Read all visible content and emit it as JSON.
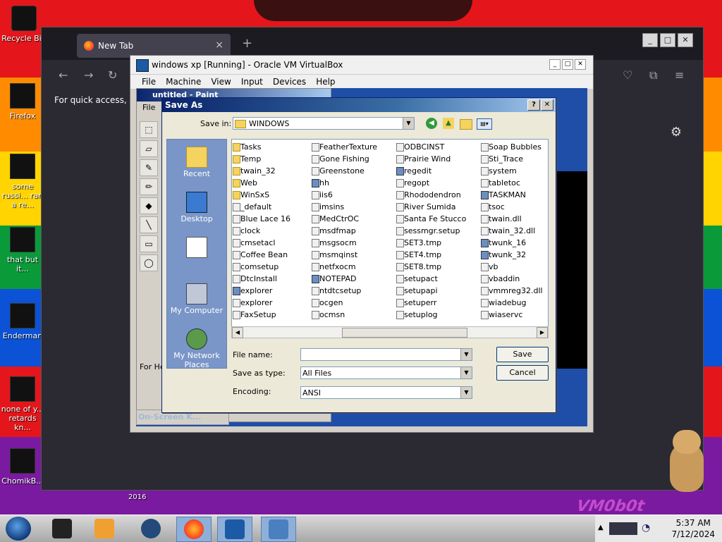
{
  "desktop": {
    "icons": [
      {
        "label": "Recycle Bin"
      },
      {
        "label": "Firefox"
      },
      {
        "label": "some russi... ran a re..."
      },
      {
        "label": "that but it..."
      },
      {
        "label": "Enderman"
      },
      {
        "label": "none of y... retards kn..."
      },
      {
        "label": "ChomikB..."
      }
    ],
    "overlay_text": "VM0b0t",
    "small_label": "2016"
  },
  "firefox": {
    "tab_title": "New Tab",
    "bookmarks_hint": "For quick access, pla",
    "new_tab_symbol": "+"
  },
  "vbox": {
    "title": "windows xp [Running] - Oracle VM VirtualBox",
    "menu": [
      "File",
      "Machine",
      "View",
      "Input",
      "Devices",
      "Help"
    ]
  },
  "paint": {
    "title": "untitled - Paint",
    "menu_file": "File",
    "status": "For He",
    "osk_title": "On-Screen K..."
  },
  "dialog": {
    "title": "Save As",
    "save_in_label": "Save in:",
    "save_in_value": "WINDOWS",
    "places": [
      "Recent",
      "Desktop",
      "",
      "My Computer",
      "My Network Places"
    ],
    "columns": [
      [
        {
          "name": "Tasks",
          "type": "folder"
        },
        {
          "name": "Temp",
          "type": "folder"
        },
        {
          "name": "twain_32",
          "type": "folder"
        },
        {
          "name": "Web",
          "type": "folder"
        },
        {
          "name": "WinSxS",
          "type": "folder"
        },
        {
          "name": "_default",
          "type": "file"
        },
        {
          "name": "Blue Lace 16",
          "type": "file"
        },
        {
          "name": "clock",
          "type": "file"
        },
        {
          "name": "cmsetacl",
          "type": "file"
        },
        {
          "name": "Coffee Bean",
          "type": "file"
        },
        {
          "name": "comsetup",
          "type": "file"
        },
        {
          "name": "DtcInstall",
          "type": "file"
        },
        {
          "name": "explorer",
          "type": "app"
        },
        {
          "name": "explorer",
          "type": "file"
        },
        {
          "name": "FaxSetup",
          "type": "file"
        }
      ],
      [
        {
          "name": "FeatherTexture",
          "type": "file"
        },
        {
          "name": "Gone Fishing",
          "type": "file"
        },
        {
          "name": "Greenstone",
          "type": "file"
        },
        {
          "name": "hh",
          "type": "app"
        },
        {
          "name": "iis6",
          "type": "file"
        },
        {
          "name": "imsins",
          "type": "file"
        },
        {
          "name": "MedCtrOC",
          "type": "file"
        },
        {
          "name": "msdfmap",
          "type": "file"
        },
        {
          "name": "msgsocm",
          "type": "file"
        },
        {
          "name": "msmqinst",
          "type": "file"
        },
        {
          "name": "netfxocm",
          "type": "file"
        },
        {
          "name": "NOTEPAD",
          "type": "app"
        },
        {
          "name": "ntdtcsetup",
          "type": "file"
        },
        {
          "name": "ocgen",
          "type": "file"
        },
        {
          "name": "ocmsn",
          "type": "file"
        }
      ],
      [
        {
          "name": "ODBCINST",
          "type": "file"
        },
        {
          "name": "Prairie Wind",
          "type": "file"
        },
        {
          "name": "regedit",
          "type": "app"
        },
        {
          "name": "regopt",
          "type": "file"
        },
        {
          "name": "Rhododendron",
          "type": "file"
        },
        {
          "name": "River Sumida",
          "type": "file"
        },
        {
          "name": "Santa Fe Stucco",
          "type": "file"
        },
        {
          "name": "sessmgr.setup",
          "type": "file"
        },
        {
          "name": "SET3.tmp",
          "type": "file"
        },
        {
          "name": "SET4.tmp",
          "type": "file"
        },
        {
          "name": "SET8.tmp",
          "type": "file"
        },
        {
          "name": "setupact",
          "type": "file"
        },
        {
          "name": "setupapi",
          "type": "file"
        },
        {
          "name": "setuperr",
          "type": "file"
        },
        {
          "name": "setuplog",
          "type": "file"
        }
      ],
      [
        {
          "name": "Soap Bubbles",
          "type": "file"
        },
        {
          "name": "Sti_Trace",
          "type": "file"
        },
        {
          "name": "system",
          "type": "file"
        },
        {
          "name": "tabletoc",
          "type": "file"
        },
        {
          "name": "TASKMAN",
          "type": "app"
        },
        {
          "name": "tsoc",
          "type": "file"
        },
        {
          "name": "twain.dll",
          "type": "file"
        },
        {
          "name": "twain_32.dll",
          "type": "file"
        },
        {
          "name": "twunk_16",
          "type": "app"
        },
        {
          "name": "twunk_32",
          "type": "app"
        },
        {
          "name": "vb",
          "type": "file"
        },
        {
          "name": "vbaddin",
          "type": "file"
        },
        {
          "name": "vmmreg32.dll",
          "type": "file"
        },
        {
          "name": "wiadebug",
          "type": "file"
        },
        {
          "name": "wiaservc",
          "type": "file"
        }
      ]
    ],
    "file_name_label": "File name:",
    "file_name_value": "",
    "save_as_type_label": "Save as type:",
    "save_as_type_value": "All Files",
    "encoding_label": "Encoding:",
    "encoding_value": "ANSI",
    "save_button": "Save",
    "cancel_button": "Cancel",
    "help_button": "?",
    "close_button": "✕"
  },
  "taskbar": {
    "clock_time": "5:37 AM",
    "clock_date": "7/12/2024"
  }
}
